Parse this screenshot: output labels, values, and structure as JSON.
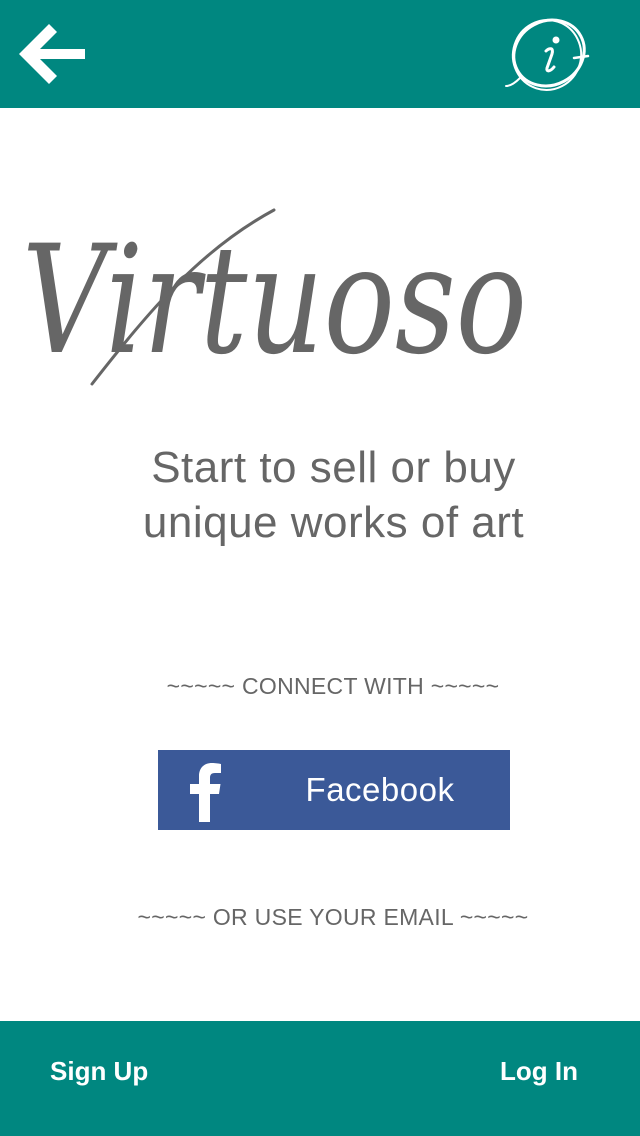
{
  "colors": {
    "bar_background": "#008780",
    "facebook_blue": "#3b5998",
    "text_gray": "#666666",
    "white": "#ffffff"
  },
  "header": {
    "back_icon": "arrow-left-icon",
    "info_icon": "info-icon"
  },
  "logo": {
    "text": "Virtuoso"
  },
  "tagline": {
    "line1": "Start to sell or buy",
    "line2": "unique works of art"
  },
  "connect": {
    "divider_label": "~~~~~ CONNECT WITH ~~~~~",
    "facebook_icon": "facebook-icon",
    "facebook_label": "Facebook",
    "email_divider_label": "~~~~~ OR USE YOUR EMAIL ~~~~~"
  },
  "footer": {
    "signup_label": "Sign Up",
    "login_label": "Log In"
  }
}
